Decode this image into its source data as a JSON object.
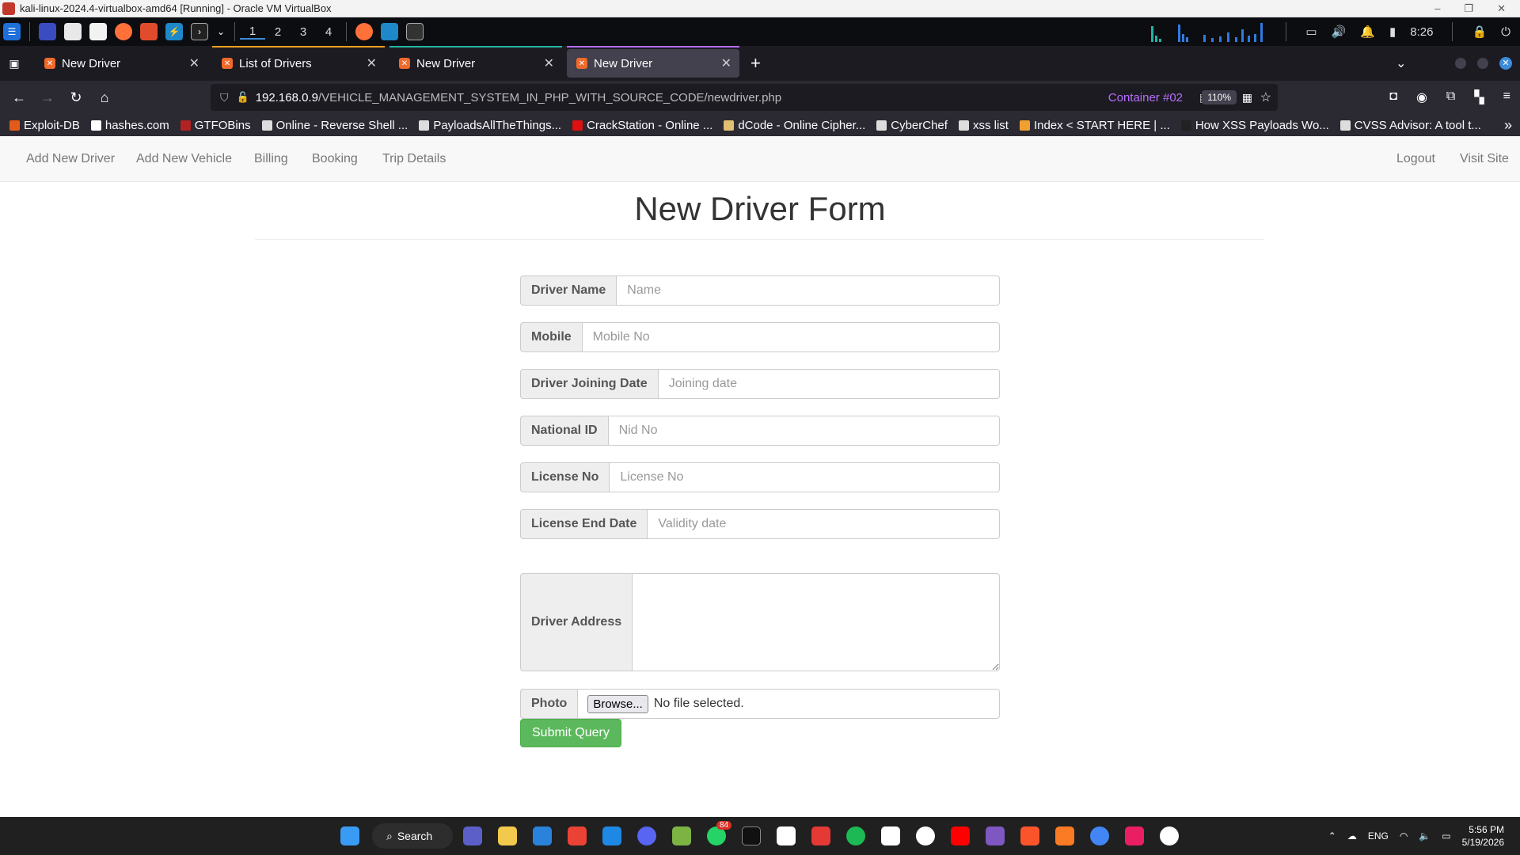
{
  "vbox": {
    "title": "kali-linux-2024.4-virtualbox-amd64 [Running] - Oracle VM VirtualBox",
    "minimize": "–",
    "restore": "❐",
    "close": "✕"
  },
  "kali_panel": {
    "workspaces": [
      "1",
      "2",
      "3",
      "4"
    ],
    "time": "8:26"
  },
  "firefox": {
    "tabs": [
      {
        "label": "New Driver",
        "active": false
      },
      {
        "label": "List of Drivers",
        "active": false
      },
      {
        "label": "New Driver",
        "active": false
      },
      {
        "label": "New Driver",
        "active": true
      }
    ],
    "new_tab": "+",
    "url_host": "192.168.0.9",
    "url_path": "/VEHICLE_MANAGEMENT_SYSTEM_IN_PHP_WITH_SOURCE_CODE/newdriver.php",
    "container": "Container #02",
    "zoom": "110%",
    "bookmarks": [
      {
        "label": "Exploit-DB",
        "color": "#e35b1a"
      },
      {
        "label": "hashes.com",
        "color": "#ffffff"
      },
      {
        "label": "GTFOBins",
        "color": "#b22222"
      },
      {
        "label": "Online - Reverse Shell ...",
        "color": "#dddddd"
      },
      {
        "label": "PayloadsAllTheThings...",
        "color": "#dddddd"
      },
      {
        "label": "CrackStation - Online ...",
        "color": "#d11"
      },
      {
        "label": "dCode - Online Cipher...",
        "color": "#e0c070"
      },
      {
        "label": "CyberChef",
        "color": "#dddddd"
      },
      {
        "label": "xss list",
        "color": "#dddddd"
      },
      {
        "label": "Index < START HERE | ...",
        "color": "#f0a030"
      },
      {
        "label": "How XSS Payloads Wo...",
        "color": "#222222"
      },
      {
        "label": "CVSS Advisor: A tool t...",
        "color": "#dddddd"
      }
    ],
    "overflow": "»"
  },
  "site": {
    "nav_left": [
      "Add New Driver",
      "Add New Vehicle",
      "Billing",
      "Booking",
      "Trip Details"
    ],
    "nav_right": [
      "Logout",
      "Visit Site"
    ],
    "title": "New Driver Form",
    "fields": [
      {
        "label": "Driver Name",
        "placeholder": "Name"
      },
      {
        "label": "Mobile",
        "placeholder": "Mobile No"
      },
      {
        "label": "Driver Joining Date",
        "placeholder": "Joining date"
      },
      {
        "label": "National ID",
        "placeholder": "Nid No"
      },
      {
        "label": "License No",
        "placeholder": "License No"
      },
      {
        "label": "License End Date",
        "placeholder": "Validity date"
      }
    ],
    "address_label": "Driver Address",
    "photo_label": "Photo",
    "browse_label": "Browse...",
    "file_status": "No file selected.",
    "submit_label": "Submit Query"
  },
  "taskbar": {
    "search_label": "Search",
    "whatsapp_badge": "84",
    "lang": "ENG",
    "time": "5:56 PM",
    "date": "5/19/2026"
  }
}
